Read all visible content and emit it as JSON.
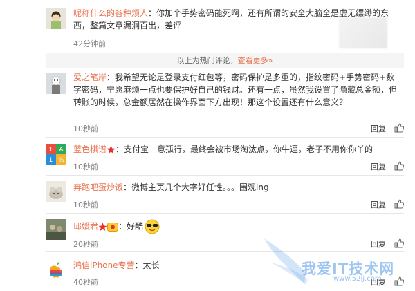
{
  "comments_top": [
    {
      "name": "昵称什么的各种烦人",
      "text": "：你加个手势密码能死啊，还有所谓的安全大脑全是虚无缥缈的东西，整篇文章漏洞百出，差评",
      "time": "42分钟前"
    }
  ],
  "hot_bar": {
    "text": "以上为热门评论，",
    "link": "查看更多»"
  },
  "comments": [
    {
      "name": "爱之笔岸",
      "text": "：我希望无论是登录支付红包等，密码保护是多重的，指纹密码+手势密码+数字密码，宁愿麻烦一点也要保护好自己的钱财。还有一点，虽然我设置了隐藏总金额，但转账的时候，总金额居然在操作界面下方出现！那这个设置还有什么意义？",
      "time": "10秒前",
      "reply": "回复"
    },
    {
      "name": "蓝色棋谱",
      "text": "：支付宝一意孤行，最终会被市场淘汰点，你牛逼，老子不用你你丫的",
      "time": "10秒前",
      "reply": "回复"
    },
    {
      "name": "奔跑吧蛋炒饭",
      "text": "：微博主页几个大字好任性。。。围观ing",
      "time": "10秒前",
      "reply": "回复"
    },
    {
      "name": "邱媛君",
      "text": "：好酷",
      "time": "20秒前",
      "reply": "回复"
    },
    {
      "name": "鸿信iPhone专营",
      "text": "：太长",
      "time": "40秒前",
      "reply": "回复"
    }
  ],
  "avatar_grid_labels": [
    "1",
    "A",
    "1",
    "%"
  ],
  "watermark": {
    "text": "我爱IT技术网",
    "url": "www.52ij.com"
  },
  "colors": {
    "name": "#eb7350",
    "time": "#808080",
    "star": "#e5322d"
  }
}
